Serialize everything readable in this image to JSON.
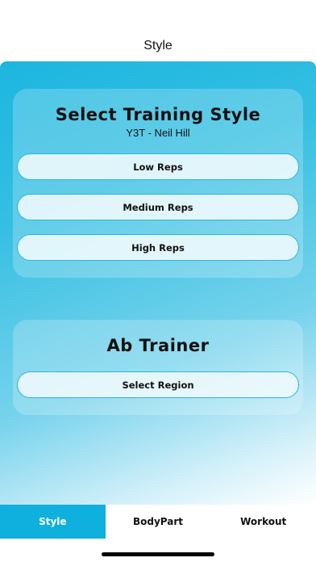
{
  "nav": {
    "title": "Style"
  },
  "training": {
    "title": "Select Training Style",
    "subtitle": "Y3T - Neil Hill",
    "options": [
      {
        "label": "Low Reps"
      },
      {
        "label": "Medium Reps"
      },
      {
        "label": "High Reps"
      }
    ]
  },
  "ab": {
    "title": "Ab Trainer",
    "button_label": "Select Region"
  },
  "tabs": [
    {
      "label": "Style",
      "active": true
    },
    {
      "label": "BodyPart",
      "active": false
    },
    {
      "label": "Workout",
      "active": false
    }
  ],
  "colors": {
    "accent": "#0fb0dd",
    "gradient_top": "#1cb6df",
    "gradient_bottom": "#ffffff",
    "pill_border": "#28b4de"
  }
}
